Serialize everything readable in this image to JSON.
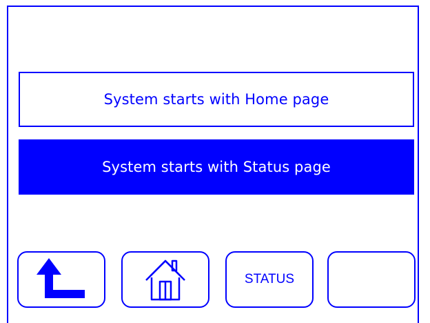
{
  "options": {
    "home_label": "System starts with Home page",
    "status_label": "System starts with Status page"
  },
  "nav": {
    "back_icon": "return-arrow-icon",
    "home_icon": "house-icon",
    "status_label": "STATUS",
    "blank_label": ""
  },
  "colors": {
    "accent": "#0000ff",
    "background": "#ffffff",
    "selected_text": "#ffffff"
  }
}
